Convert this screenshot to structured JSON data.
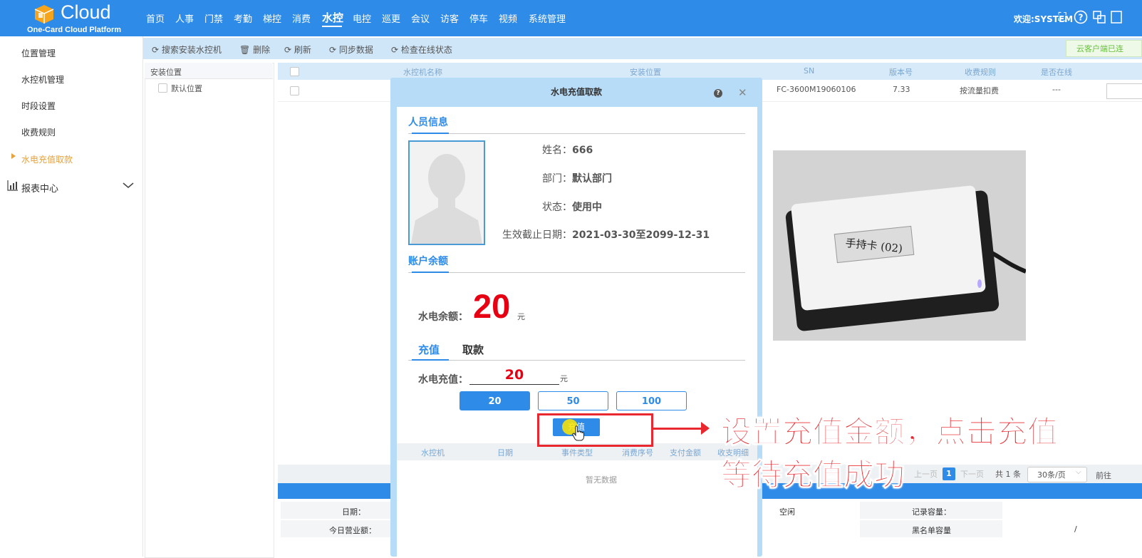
{
  "header": {
    "logo_text": "Cloud",
    "logo_subtitle": "One-Card Cloud Platform",
    "nav": [
      "首页",
      "人事",
      "门禁",
      "考勤",
      "梯控",
      "消费",
      "水控",
      "电控",
      "巡更",
      "会议",
      "访客",
      "停车",
      "视频",
      "系统管理"
    ],
    "active_nav": "水控",
    "welcome": "欢迎:SYSTEM",
    "icons": [
      "fullscreen-icon",
      "help-icon",
      "language-icon",
      "logout-icon"
    ]
  },
  "sidebar": {
    "items": [
      "位置管理",
      "水控机管理",
      "时段设置",
      "收费规则",
      "水电充值取款"
    ],
    "active_item": "水电充值取款",
    "report": "报表中心"
  },
  "toolbar": {
    "buttons": [
      "搜索安装水控机",
      "删除",
      "刷新",
      "同步数据",
      "检查在线状态"
    ],
    "cloud_status": "云客户端已连"
  },
  "tree": {
    "header": "安装位置",
    "items": [
      "默认位置"
    ]
  },
  "table": {
    "headers": [
      "水控机名称",
      "安装位置",
      "SN",
      "版本号",
      "收费规则",
      "是否在线"
    ],
    "rows": [
      {
        "sn": "FC-3600M19060106",
        "version": "7.33",
        "rule": "按流量扣费",
        "online": "---"
      }
    ]
  },
  "pager": {
    "prev": "上一页",
    "page": "1",
    "next": "下一页",
    "total": "共 1 条",
    "size": "30条/页",
    "goto": "前往"
  },
  "info": {
    "date_label": "日期：",
    "today_label": "今日营业额：",
    "status": "空闲",
    "record_capacity": "记录容量：",
    "blacklist_capacity": "黑名单容量",
    "blacklist_value": "/"
  },
  "modal": {
    "title": "水电充值取款",
    "person_section": "人员信息",
    "name_label": "姓名：",
    "name_value": "666",
    "dept_label": "部门：",
    "dept_value": "默认部门",
    "status_label": "状态：",
    "status_value": "使用中",
    "valid_label": "生效截止日期：",
    "valid_value": "2021-03-30至2099-12-31",
    "balance_section": "账户余额",
    "balance_label": "水电余额：",
    "balance_value": "20",
    "balance_unit": "元",
    "tab_recharge": "充值",
    "tab_withdraw": "取款",
    "recharge_label": "水电充值：",
    "recharge_value": "20",
    "recharge_unit": "元",
    "amounts": [
      "20",
      "50",
      "100"
    ],
    "selected_amount": "20",
    "submit_label": "充值",
    "log_headers": [
      "水控机",
      "日期",
      "事件类型",
      "消费序号",
      "支付金额",
      "收支明细"
    ],
    "empty": "暂无数据"
  },
  "photo": {
    "card_label": "手持卡 (02)"
  },
  "annotation": {
    "line1": "设置充值金额，点击充值",
    "line2": "等待充值成功",
    "color": "#e8282e"
  }
}
